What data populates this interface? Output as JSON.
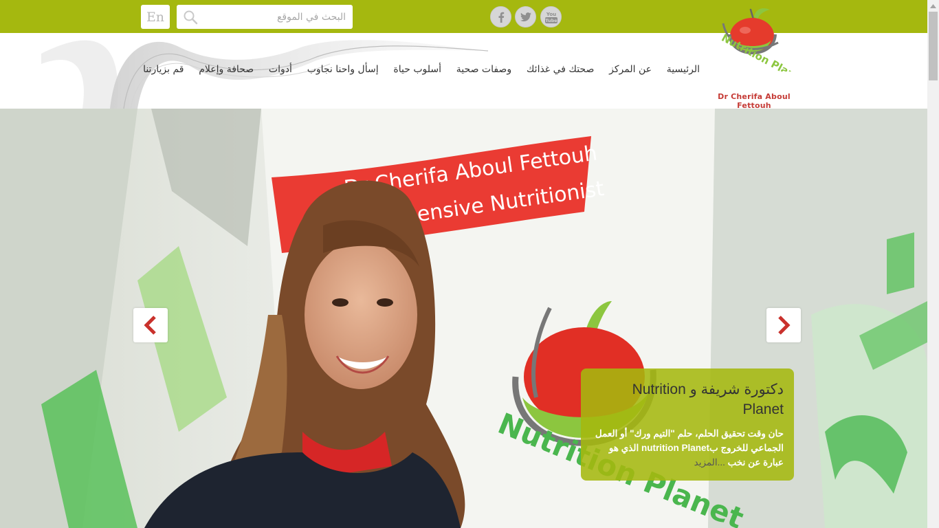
{
  "topbar": {
    "lang_label": "En",
    "search_placeholder": "البحث في الموقع",
    "social": [
      "facebook-icon",
      "twitter-icon",
      "youtube-icon"
    ],
    "youtube_label": "You Tube",
    "bg_color": "#a5b80f"
  },
  "header": {
    "nav": [
      "الرئيسية",
      "عن المركز",
      "صحتك في غذائك",
      "وصفات صحية",
      "أسلوب حياة",
      "إسأل واحنا نجاوب",
      "أدوات",
      "صحافة وإعلام",
      "قم بزيارتنا"
    ],
    "logo_text": "Nutrition Planet",
    "logo_sub": "Dr Cherifa Aboul Fettouh"
  },
  "hero": {
    "banner_line1": "Dr Cherifa Aboul Fettouh",
    "banner_line2": "Comprehensive Nutritionist",
    "watermark": "Nutrition Planet",
    "caption_title": "دكتورة شريفة و Nutrition Planet",
    "caption_text": "حان وقت تحقيق الحلم، حلم \"التيم ورك\" أو العمل الجماعي للخروج بnutrition Planet الذي هو عبارة عن نخب",
    "caption_more": "...المزيد",
    "prev_icon": "chevron-left-icon",
    "next_icon": "chevron-right-icon"
  }
}
